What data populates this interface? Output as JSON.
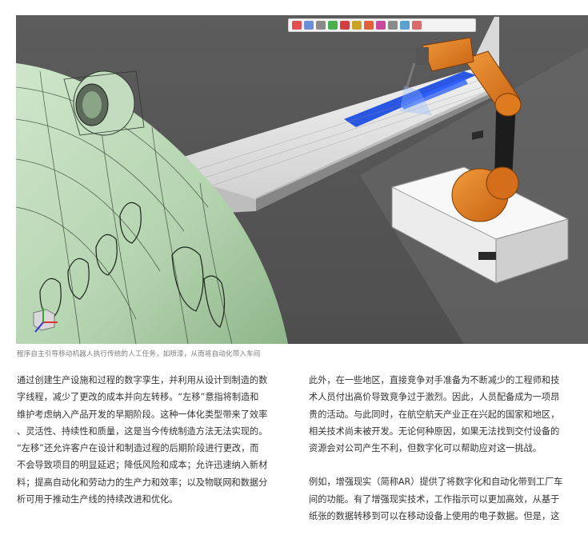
{
  "figure": {
    "caption": "程序自主引导移动机器人执行传统的人工任务，如喷漆，从而将自动化带入车间",
    "toolbar_icons": [
      "zoom-icon",
      "search-icon",
      "rotate-icon",
      "palette-icon",
      "view-icon",
      "move-icon",
      "settings-icon",
      "filter-icon",
      "layers-icon",
      "camera-icon",
      "grid-icon"
    ],
    "colors": {
      "background": "#5a5a5a",
      "fuselage": "#b9d7b5",
      "wing": "#e8e8e8",
      "paint": "#1f4fe0",
      "robot_arm": "#e07a1f",
      "robot_base": "#e9e9e9"
    }
  },
  "body": {
    "left_paragraphs": [
      "通过创建生产设施和过程的数字孪生，并利用从设计到制造的数\n字线程，减少了更改的成本并向左转移。“左移”意指将制造和\n维护考虑纳入产品开发的早期阶段。这种一体化类型带来了效率\n、灵活性、持续性和质量，这是当今传统制造方法无法实现的。\n“左移”还允许客户在设计和制造过程的后期阶段进行更改，而\n不会导致项目的明显延迟；降低风险和成本；允许迅速纳入新材\n料；提高自动化和劳动力的生产力和效率；以及物联网和数据分\n析可用于推动生产线的持续改进和优化。"
    ],
    "right_paragraphs": [
      "此外，在一些地区，直接竞争对手准备为不断减少的工程师和技\n术人员付出高价导致竞争过于激烈。因此，人员配备成为一项昂\n贵的活动。与此同时，在航空航天产业正在兴起的国家和地区，\n相关技术尚未被开发。无论何种原因，如果无法找到交付设备的\n资源会对公司产生不利，但数字化可以帮助应对这一挑战。",
      "例如，增强现实（简称AR）提供了将数字化和自动化带到工厂车\n间的功能。有了增强现实技术，工作指示可以更加高效，从基于\n纸张的数据转移到可以在移动设备上使用的电子数据。但是，这"
    ]
  }
}
